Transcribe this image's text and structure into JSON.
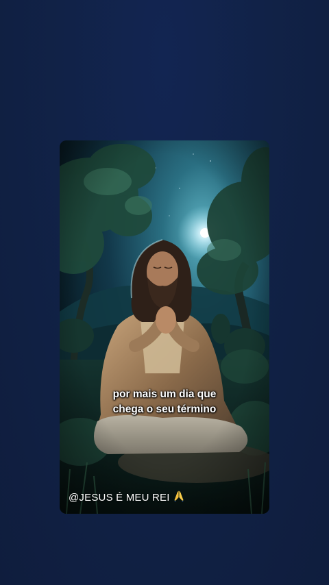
{
  "post": {
    "caption_lines": [
      "por mais um dia que",
      "chega o seu término"
    ],
    "watermark": "@JESUS É MEU REI",
    "watermark_icon": "praying-hands-icon"
  },
  "colors": {
    "background": "#112247",
    "text": "#ffffff",
    "moonlight": "#e6fbff"
  }
}
